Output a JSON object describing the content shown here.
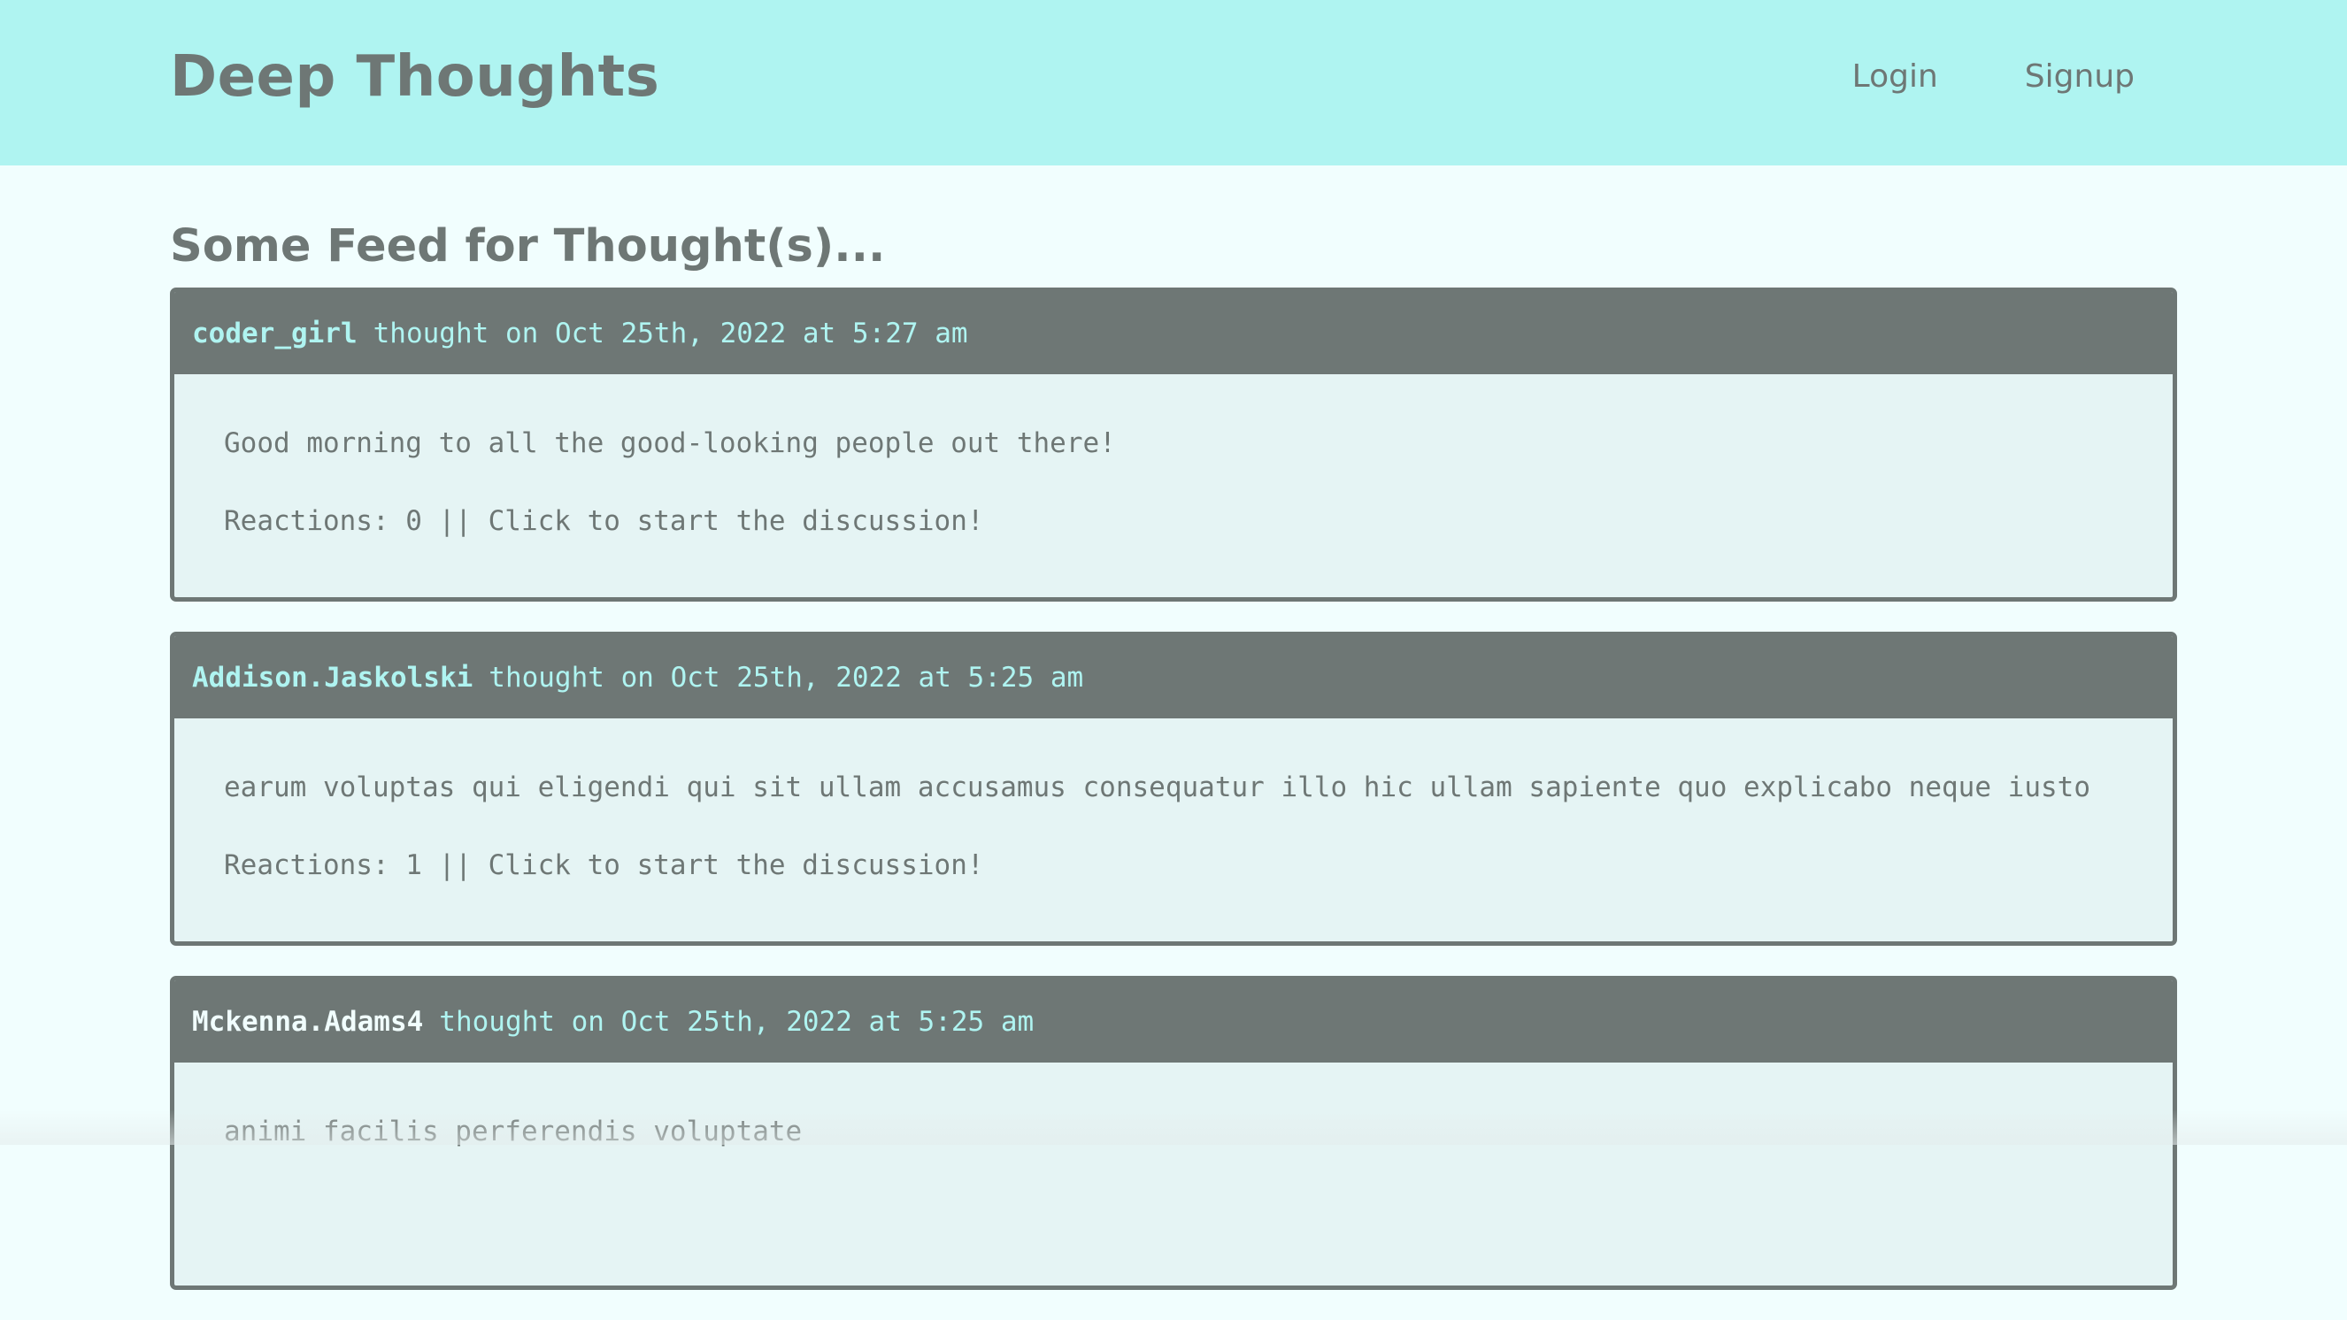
{
  "header": {
    "title": "Deep Thoughts",
    "nav": [
      {
        "label": "Login"
      },
      {
        "label": "Signup"
      }
    ]
  },
  "feed": {
    "title": "Some Feed for Thought(s)...",
    "thoughts": [
      {
        "username": "coder_girl",
        "meta": "thought on Oct 25th, 2022 at 5:27 am",
        "text": "Good morning to all the good-looking people out there!",
        "reactions": "Reactions: 0 || Click to start the discussion!"
      },
      {
        "username": "Addison.Jaskolski",
        "meta": "thought on Oct 25th, 2022 at 5:25 am",
        "text": "earum voluptas qui eligendi qui sit ullam accusamus consequatur illo hic ullam sapiente quo explicabo neque iusto",
        "reactions": "Reactions: 1 || Click to start the discussion!"
      },
      {
        "username": "Mckenna.Adams4",
        "meta": "thought on Oct 25th, 2022 at 5:25 am",
        "text": "animi facilis perferendis voluptate",
        "reactions": ""
      }
    ]
  },
  "colors": {
    "header_bg": "#aff4f1",
    "page_bg": "#f1fefe",
    "card_border": "#6e7775",
    "card_bg": "#e5f4f4",
    "text": "#6e7775"
  }
}
